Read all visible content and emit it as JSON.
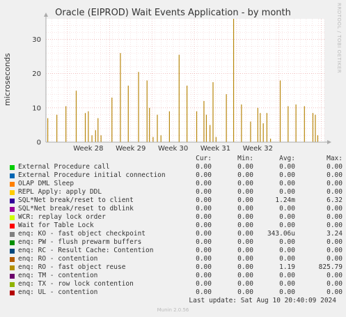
{
  "chart_data": {
    "type": "line",
    "title": "Oracle (EIPROD) Wait Events Application - by month",
    "ylabel": "microseconds",
    "watermark": "RRDTOOL / TOBI OETIKER",
    "ylim": [
      0,
      36
    ],
    "yticks": [
      0,
      10,
      20,
      30
    ],
    "x_ticks": [
      "Week 28",
      "Week 29",
      "Week 30",
      "Week 31",
      "Week 32"
    ],
    "series": [
      {
        "name": "enq: RO - fast object reuse",
        "color": "#b8860b",
        "spikes": [
          {
            "d": 0.3,
            "v": 7
          },
          {
            "d": 1.8,
            "v": 8
          },
          {
            "d": 3.3,
            "v": 10.5
          },
          {
            "d": 5.0,
            "v": 15
          },
          {
            "d": 6.5,
            "v": 8.5
          },
          {
            "d": 7.0,
            "v": 9
          },
          {
            "d": 7.6,
            "v": 2
          },
          {
            "d": 8.2,
            "v": 3.5
          },
          {
            "d": 8.6,
            "v": 7
          },
          {
            "d": 9.1,
            "v": 2
          },
          {
            "d": 10.9,
            "v": 13
          },
          {
            "d": 12.3,
            "v": 26
          },
          {
            "d": 13.6,
            "v": 16.5
          },
          {
            "d": 15.3,
            "v": 20.5
          },
          {
            "d": 16.7,
            "v": 18
          },
          {
            "d": 17.1,
            "v": 10
          },
          {
            "d": 17.7,
            "v": 1.5
          },
          {
            "d": 18.4,
            "v": 8
          },
          {
            "d": 19.0,
            "v": 2
          },
          {
            "d": 20.4,
            "v": 9
          },
          {
            "d": 22.0,
            "v": 25.5
          },
          {
            "d": 23.3,
            "v": 16.5
          },
          {
            "d": 24.9,
            "v": 9
          },
          {
            "d": 26.1,
            "v": 12
          },
          {
            "d": 26.5,
            "v": 8
          },
          {
            "d": 27.1,
            "v": 5
          },
          {
            "d": 27.6,
            "v": 17.5
          },
          {
            "d": 28.1,
            "v": 1.5
          },
          {
            "d": 29.8,
            "v": 14
          },
          {
            "d": 31.0,
            "v": 36
          },
          {
            "d": 32.3,
            "v": 11
          },
          {
            "d": 33.8,
            "v": 6
          },
          {
            "d": 35.0,
            "v": 10
          },
          {
            "d": 35.4,
            "v": 8.5
          },
          {
            "d": 35.9,
            "v": 5.5
          },
          {
            "d": 36.5,
            "v": 8.5
          },
          {
            "d": 37.1,
            "v": 1
          },
          {
            "d": 38.7,
            "v": 18
          },
          {
            "d": 40.0,
            "v": 10.5
          },
          {
            "d": 41.3,
            "v": 11
          },
          {
            "d": 42.7,
            "v": 10.5
          },
          {
            "d": 44.1,
            "v": 8.5
          },
          {
            "d": 44.5,
            "v": 8
          },
          {
            "d": 44.9,
            "v": 2
          }
        ]
      }
    ]
  },
  "legend": {
    "headers": [
      "Cur:",
      "Min:",
      "Avg:",
      "Max:"
    ],
    "rows": [
      {
        "name": "External Procedure call",
        "color": "#00cc00",
        "cur": "0.00",
        "min": "0.00",
        "avg": "0.00",
        "max": "0.00"
      },
      {
        "name": "External Procedure initial connection",
        "color": "#0066b3",
        "cur": "0.00",
        "min": "0.00",
        "avg": "0.00",
        "max": "0.00"
      },
      {
        "name": "OLAP DML Sleep",
        "color": "#ff8000",
        "cur": "0.00",
        "min": "0.00",
        "avg": "0.00",
        "max": "0.00"
      },
      {
        "name": "REPL Apply: apply DDL",
        "color": "#ffcc00",
        "cur": "0.00",
        "min": "0.00",
        "avg": "0.00",
        "max": "0.00"
      },
      {
        "name": "SQL*Net break/reset to client",
        "color": "#330099",
        "cur": "0.00",
        "min": "0.00",
        "avg": "1.24m",
        "max": "6.32"
      },
      {
        "name": "SQL*Net break/reset to dblink",
        "color": "#990099",
        "cur": "0.00",
        "min": "0.00",
        "avg": "0.00",
        "max": "0.00"
      },
      {
        "name": "WCR: replay lock order",
        "color": "#ccff00",
        "cur": "0.00",
        "min": "0.00",
        "avg": "0.00",
        "max": "0.00"
      },
      {
        "name": "Wait for Table Lock",
        "color": "#ff0000",
        "cur": "0.00",
        "min": "0.00",
        "avg": "0.00",
        "max": "0.00"
      },
      {
        "name": "enq: KO - fast object checkpoint",
        "color": "#808080",
        "cur": "0.00",
        "min": "0.00",
        "avg": "343.06u",
        "max": "3.24"
      },
      {
        "name": "enq: PW - flush prewarm buffers",
        "color": "#008f00",
        "cur": "0.00",
        "min": "0.00",
        "avg": "0.00",
        "max": "0.00"
      },
      {
        "name": "enq: RC - Result Cache: Contention",
        "color": "#00487d",
        "cur": "0.00",
        "min": "0.00",
        "avg": "0.00",
        "max": "0.00"
      },
      {
        "name": "enq: RO - contention",
        "color": "#b35a00",
        "cur": "0.00",
        "min": "0.00",
        "avg": "0.00",
        "max": "0.00"
      },
      {
        "name": "enq: RO - fast object reuse",
        "color": "#b38f00",
        "cur": "0.00",
        "min": "0.00",
        "avg": "1.19",
        "max": "825.79"
      },
      {
        "name": "enq: TM - contention",
        "color": "#6b006b",
        "cur": "0.00",
        "min": "0.00",
        "avg": "0.00",
        "max": "0.00"
      },
      {
        "name": "enq: TX - row lock contention",
        "color": "#8fb300",
        "cur": "0.00",
        "min": "0.00",
        "avg": "0.00",
        "max": "0.00"
      },
      {
        "name": "enq: UL - contention",
        "color": "#b30000",
        "cur": "0.00",
        "min": "0.00",
        "avg": "0.00",
        "max": "0.00"
      }
    ]
  },
  "footer": {
    "last_update": "Last update: Sat Aug 10 20:40:09 2024",
    "version": "Munin 2.0.56"
  }
}
